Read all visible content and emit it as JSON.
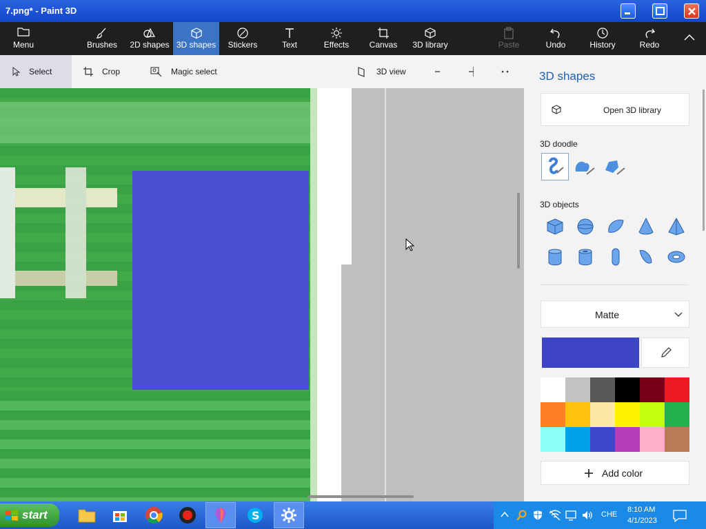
{
  "window": {
    "title": "7.png* - Paint 3D"
  },
  "ribbon": {
    "menu": "Menu",
    "tabs": [
      {
        "label": "Brushes"
      },
      {
        "label": "2D shapes"
      },
      {
        "label": "3D shapes"
      },
      {
        "label": "Stickers"
      },
      {
        "label": "Text"
      },
      {
        "label": "Effects"
      },
      {
        "label": "Canvas"
      },
      {
        "label": "3D library"
      }
    ],
    "paste": "Paste",
    "undo": "Undo",
    "history": "History",
    "redo": "Redo"
  },
  "toolbar": {
    "select": "Select",
    "crop": "Crop",
    "magic_select": "Magic select",
    "view3d": "3D view"
  },
  "panel": {
    "title": "3D shapes",
    "open_library": "Open 3D library",
    "doodle_heading": "3D doodle",
    "objects_heading": "3D objects",
    "material": "Matte",
    "add_color": "Add color",
    "current_color": "#3e45c4",
    "colors": [
      "#ffffff",
      "#c3c3c3",
      "#585858",
      "#000000",
      "#7a0019",
      "#ed1c24",
      "#ff7f27",
      "#ffc20e",
      "#fee8a8",
      "#fff200",
      "#c4ff0e",
      "#22b14c",
      "#8cfffb",
      "#00a2e8",
      "#3f48cc",
      "#b83dba",
      "#ffaec9",
      "#b97a57"
    ]
  },
  "taskbar": {
    "start": "start",
    "language": "CHE",
    "time": "8:10 AM",
    "date": "4/1/2023"
  }
}
